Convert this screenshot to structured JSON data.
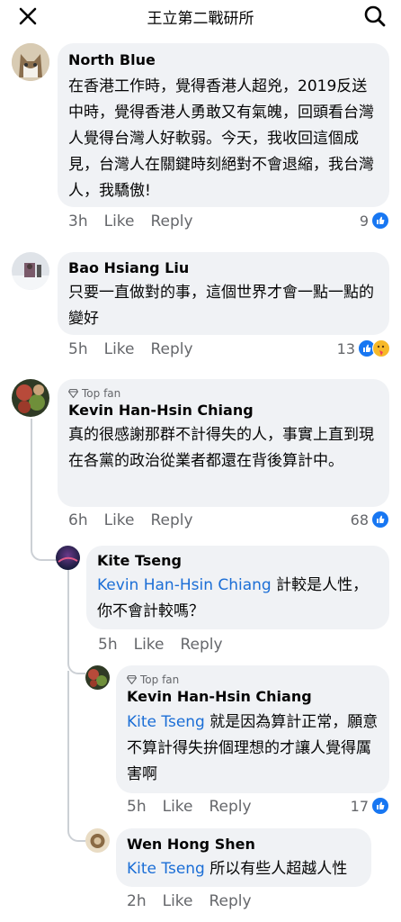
{
  "header": {
    "title": "王立第二戰研所",
    "close_icon": "close-icon",
    "search_icon": "search-icon"
  },
  "comments": [
    {
      "name": "North Blue",
      "text": "在香港工作時，覺得香港人超兇，2019反送中時，覺得香港人勇敢又有氣魄，回頭看台灣人覺得台灣人好軟弱。今天，我收回這個成見，台灣人在關鍵時刻絕對不會退縮，我台灣人，我驕傲!",
      "time": "3h",
      "like": "Like",
      "reply": "Reply",
      "reactions": "9"
    },
    {
      "name": "Bao Hsiang Liu",
      "text": "只要一直做對的事，這個世界才會一點一點的變好",
      "time": "5h",
      "like": "Like",
      "reply": "Reply",
      "reactions": "13"
    },
    {
      "badge": "Top fan",
      "name": "Kevin Han-Hsin Chiang",
      "text": "真的很感謝那群不計得失的人，事實上直到現在各黨的政治從業者都還在背後算計中。",
      "time": "6h",
      "like": "Like",
      "reply": "Reply",
      "reactions": "68"
    },
    {
      "name": "Kite Tseng",
      "mention": "Kevin Han-Hsin Chiang",
      "text": " 計較是人性，你不會計較嗎？",
      "time": "5h",
      "like": "Like",
      "reply": "Reply"
    },
    {
      "badge": "Top fan",
      "name": "Kevin Han-Hsin Chiang",
      "mention": "Kite Tseng",
      "text": " 就是因為算計正常，願意不算計得失拚個理想的才讓人覺得厲害啊",
      "time": "5h",
      "like": "Like",
      "reply": "Reply",
      "reactions": "17"
    },
    {
      "name": "Wen Hong Shen",
      "mention": "Kite Tseng",
      "text": " 所以有些人超越人性",
      "time": "2h",
      "like": "Like",
      "reply": "Reply"
    }
  ],
  "colors": {
    "bubble": "#f0f2f5",
    "link": "#1b6ed6",
    "meta": "#65676b",
    "like": "#1877f2"
  }
}
